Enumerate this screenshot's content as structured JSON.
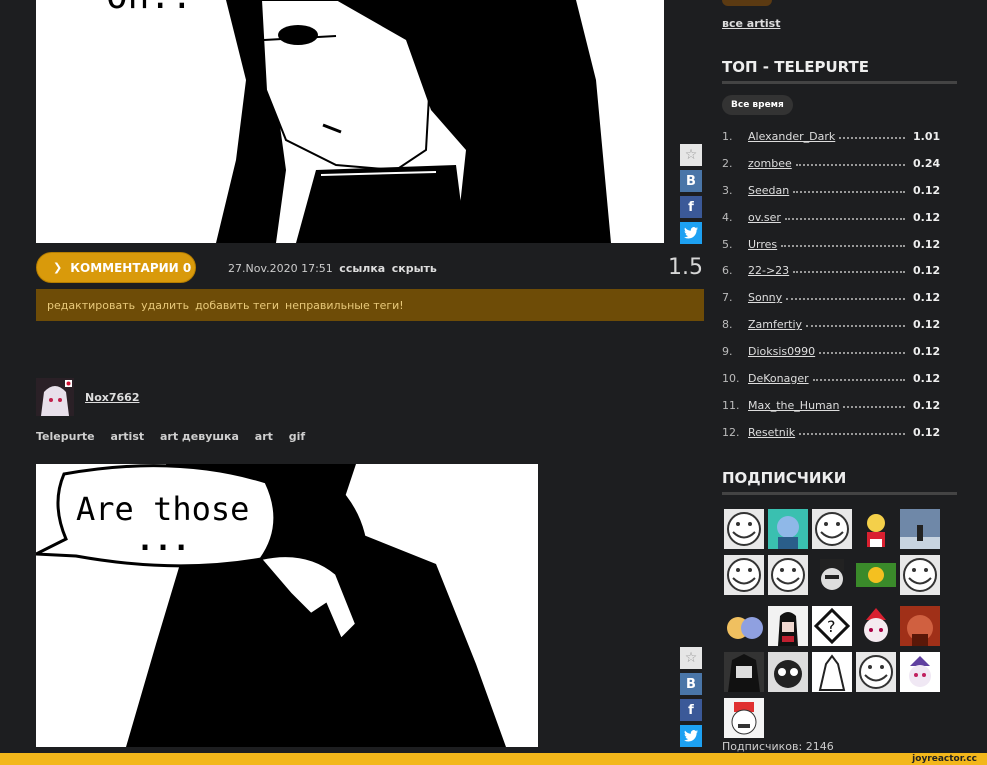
{
  "post1": {
    "speech_text": "Oh..",
    "comments_label": "КОММЕНТАРИИ 0",
    "date": "27.Nov.2020 17:51",
    "link_label": "ссылка",
    "hide_label": "скрыть",
    "rating": "1.5",
    "edit_links": [
      "редактировать",
      "удалить",
      "добавить теги",
      "неправильные теги!"
    ]
  },
  "share": {
    "vk": "B",
    "fb": "f",
    "tw": "t"
  },
  "post2": {
    "username": "Nox7662",
    "tags": [
      "Telepurte",
      "artist",
      "art девушка",
      "art",
      "gif"
    ],
    "speech_line1": "Are those",
    "speech_line2": "..."
  },
  "sidebar": {
    "all_artist": "все artist",
    "top_title": "ТОП - TELEPURTE",
    "filter_label": "Все время",
    "top": [
      {
        "num": "1.",
        "name": "Alexander_Dark",
        "value": "1.01"
      },
      {
        "num": "2.",
        "name": "zombee",
        "value": "0.24"
      },
      {
        "num": "3.",
        "name": "Seedan",
        "value": "0.12"
      },
      {
        "num": "4.",
        "name": "ov.ser",
        "value": "0.12"
      },
      {
        "num": "5.",
        "name": "Urres",
        "value": "0.12"
      },
      {
        "num": "6.",
        "name": "22->23",
        "value": "0.12"
      },
      {
        "num": "7.",
        "name": "Sonny",
        "value": "0.12"
      },
      {
        "num": "8.",
        "name": "Zamfertiy",
        "value": "0.12"
      },
      {
        "num": "9.",
        "name": "Dioksis0990",
        "value": "0.12"
      },
      {
        "num": "10.",
        "name": "DeKonager",
        "value": "0.12"
      },
      {
        "num": "11.",
        "name": "Max_the_Human",
        "value": "0.12"
      },
      {
        "num": "12.",
        "name": "Resetnik",
        "value": "0.12"
      }
    ],
    "subs_title": "ПОДПИСЧИКИ",
    "subs_count": "Подписчиков: 2146"
  },
  "footer": {
    "brand": "joyreactor.cc"
  },
  "colors": {
    "accent": "#d99a0b",
    "editbar": "#6e4c07",
    "footer": "#f3b71b"
  }
}
